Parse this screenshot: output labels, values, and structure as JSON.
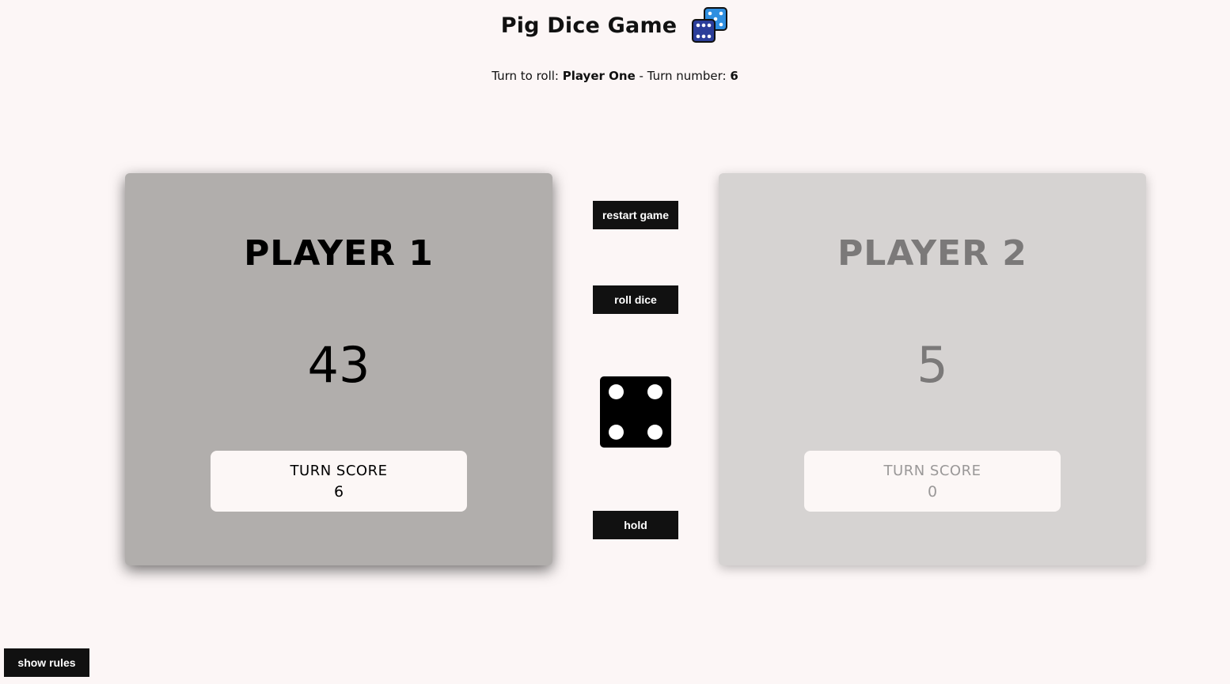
{
  "header": {
    "title": "Pig Dice Game",
    "logo_icon": "dice-icon"
  },
  "status": {
    "turn_prefix": "Turn to roll: ",
    "current_player": "Player One",
    "separator": " - Turn number: ",
    "turn_number": "6"
  },
  "players": [
    {
      "name": "PLAYER 1",
      "total_score": "43",
      "turn_score_label": "TURN SCORE",
      "turn_score": "6",
      "active": true
    },
    {
      "name": "PLAYER 2",
      "total_score": "5",
      "turn_score_label": "TURN SCORE",
      "turn_score": "0",
      "active": false
    }
  ],
  "controls": {
    "restart_label": "restart game",
    "roll_label": "roll dice",
    "hold_label": "hold",
    "rules_label": "show rules"
  },
  "dice": {
    "value": 4
  },
  "colors": {
    "background": "#fcf6f6",
    "active_panel": "#b1aeac",
    "inactive_panel": "#d6d3d2",
    "button": "#111111",
    "logo_blue": "#2f8fe0",
    "logo_navy": "#2b3e9a"
  }
}
